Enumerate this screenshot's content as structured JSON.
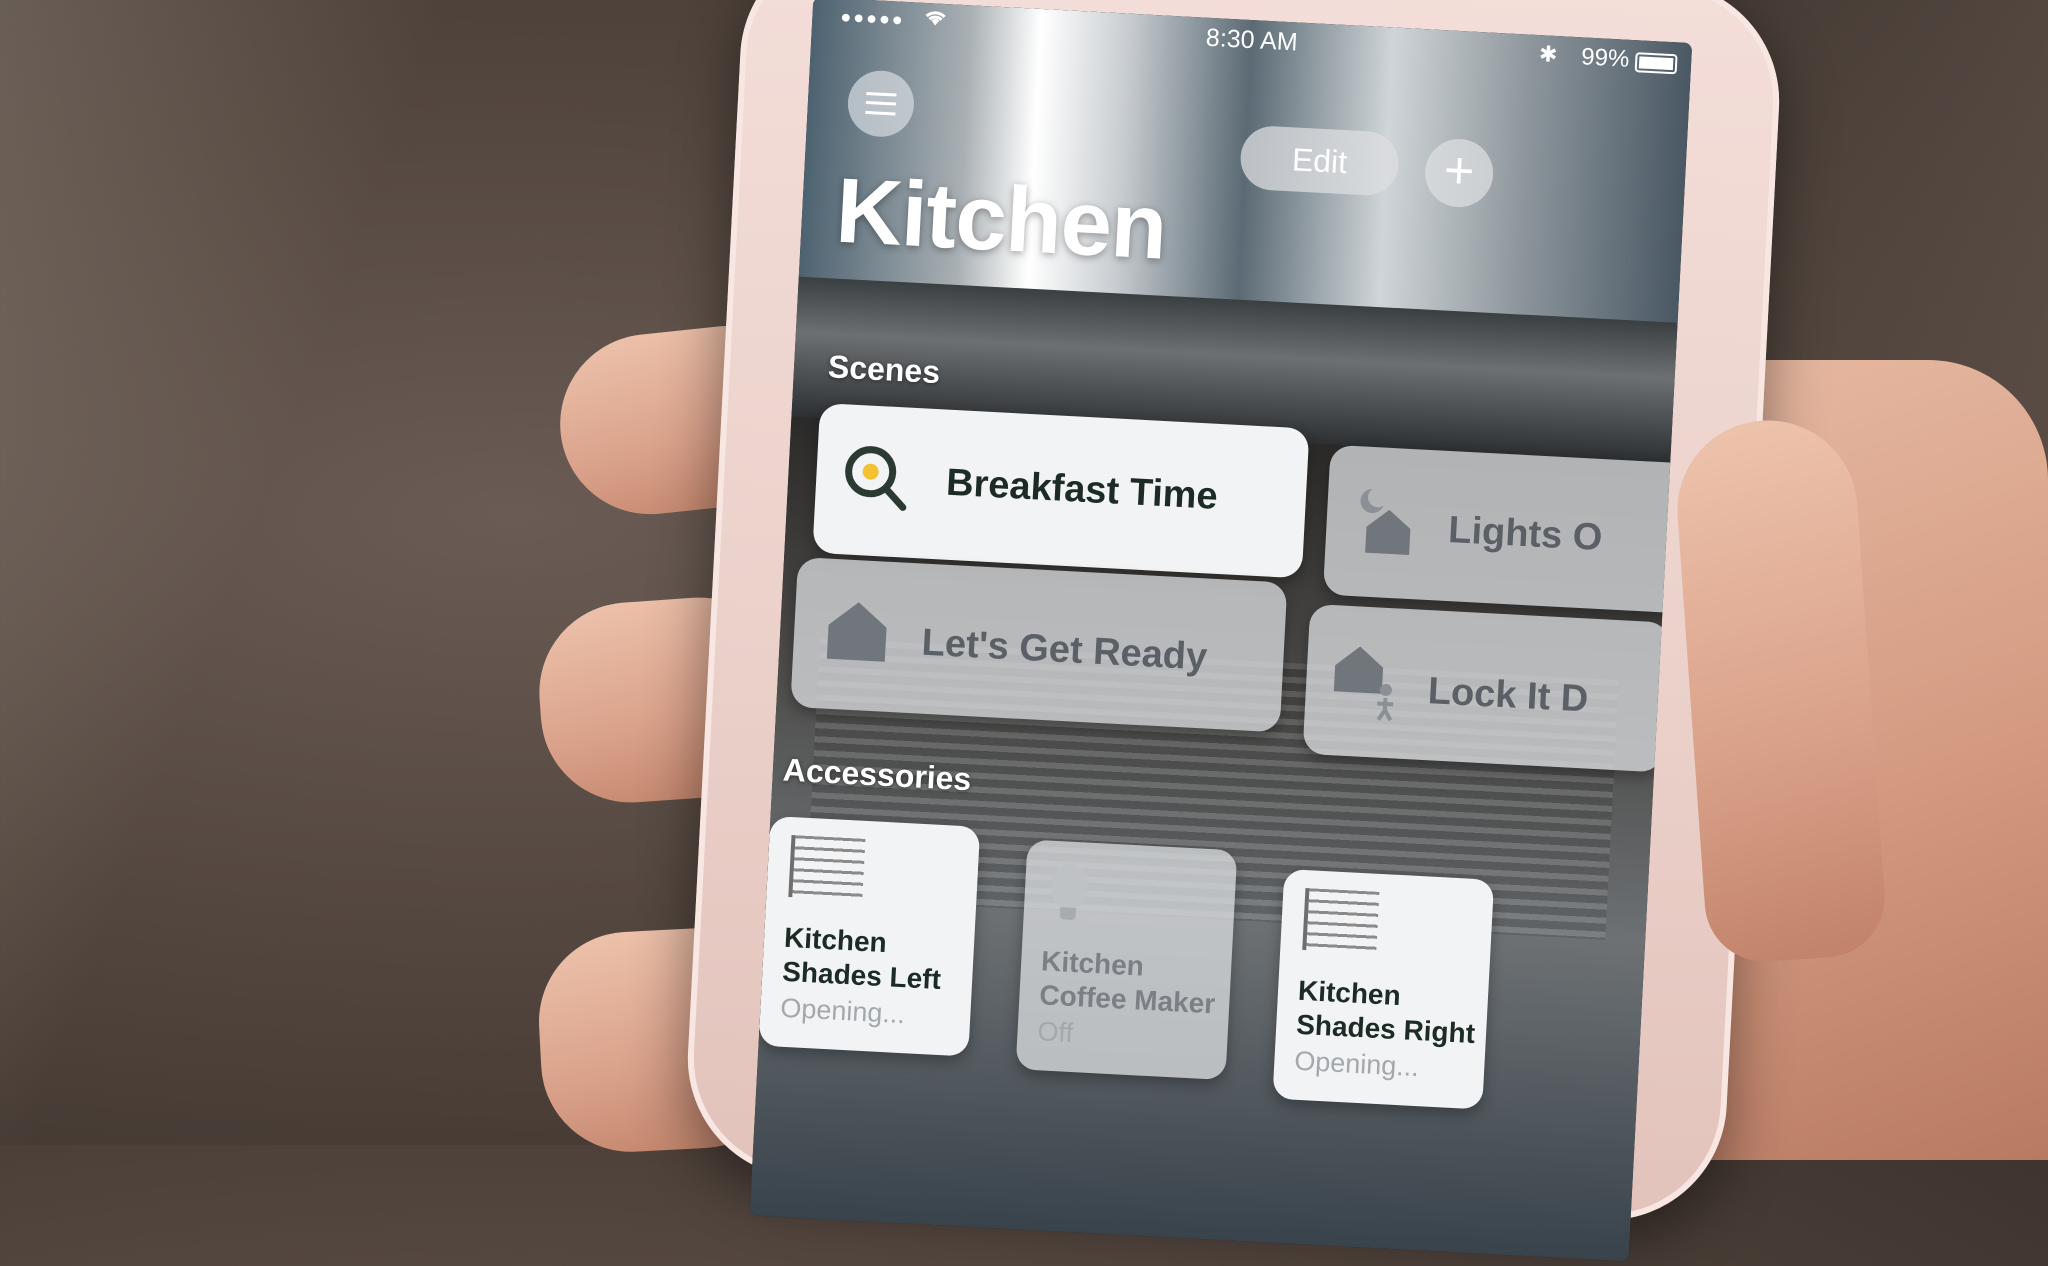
{
  "status_bar": {
    "signal": "●●●●●",
    "wifi_icon": "wifi-icon",
    "time": "8:30 AM",
    "bluetooth_icon": "bluetooth-icon",
    "battery": "99%"
  },
  "header": {
    "edit_label": "Edit",
    "add_label": "+",
    "room_title": "Kitchen"
  },
  "scenes": {
    "heading": "Scenes",
    "items": [
      {
        "label": "Breakfast Time",
        "icon": "frying-pan-icon",
        "active": true
      },
      {
        "label": "Lights O",
        "icon": "moon-house-icon",
        "active": false
      },
      {
        "label": "Let's Get Ready",
        "icon": "house-icon",
        "active": false
      },
      {
        "label": "Lock It D",
        "icon": "house-person-icon",
        "active": false
      }
    ]
  },
  "accessories": {
    "heading": "Accessories",
    "items": [
      {
        "name": "Kitchen Shades Left",
        "state": "Opening...",
        "icon": "window-shade-icon",
        "active": true
      },
      {
        "name": "Kitchen Coffee Maker",
        "state": "Off",
        "icon": "lightbulb-icon",
        "active": false
      },
      {
        "name": "Kitchen Shades Right",
        "state": "Opening...",
        "icon": "window-shade-icon",
        "active": true
      }
    ]
  },
  "colors": {
    "tile_active": "#f2f3f4",
    "tile_inactive": "#d7dadc",
    "text_active": "#1c2b26",
    "phone_body": "#ead0c9"
  }
}
